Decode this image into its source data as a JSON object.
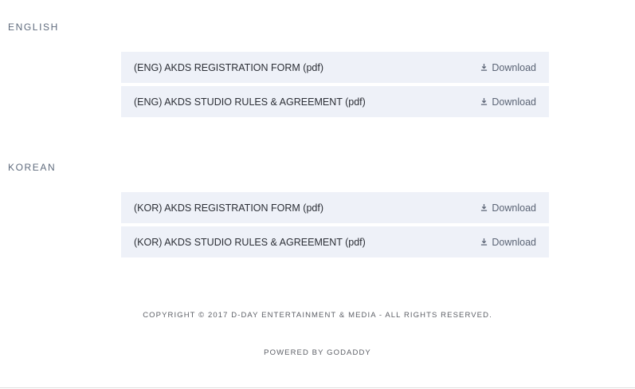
{
  "sections": [
    {
      "title": "ENGLISH",
      "files": [
        {
          "name": "(ENG) AKDS REGISTRATION FORM (pdf)",
          "action": "Download"
        },
        {
          "name": "(ENG) AKDS STUDIO RULES & AGREEMENT (pdf)",
          "action": "Download"
        }
      ]
    },
    {
      "title": "KOREAN",
      "files": [
        {
          "name": "(KOR) AKDS REGISTRATION FORM (pdf)",
          "action": "Download"
        },
        {
          "name": "(KOR) AKDS STUDIO RULES & AGREEMENT (pdf)",
          "action": "Download"
        }
      ]
    }
  ],
  "footer": {
    "copyright": "COPYRIGHT © 2017 D-DAY ENTERTAINMENT & MEDIA - ALL RIGHTS RESERVED.",
    "powered_by": "POWERED BY GODADDY"
  },
  "icons": {
    "download": "download-icon"
  },
  "colors": {
    "row_background": "#eef1f8",
    "section_title": "#5f6b7d"
  }
}
